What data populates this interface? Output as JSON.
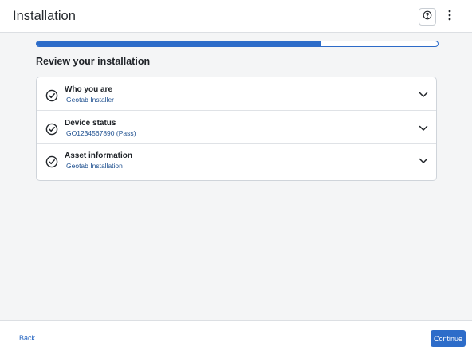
{
  "header": {
    "title": "Installation",
    "help_icon": "help-circle-icon",
    "more_icon": "more-vertical-icon"
  },
  "progress": {
    "fraction": 0.71,
    "color": "#2c6cc9"
  },
  "section_title": "Review your installation",
  "review_items": [
    {
      "title": "Who you are",
      "subtitle": "Geotab Installer",
      "status_icon": "check-circle-icon",
      "expand_icon": "chevron-down-icon"
    },
    {
      "title": "Device status",
      "subtitle": "GO1234567890 (Pass)",
      "status_icon": "check-circle-icon",
      "expand_icon": "chevron-down-icon"
    },
    {
      "title": "Asset information",
      "subtitle": "Geotab Installation",
      "status_icon": "check-circle-icon",
      "expand_icon": "chevron-down-icon"
    }
  ],
  "footer": {
    "back_label": "Back",
    "continue_label": "Continue",
    "accent": "#2d6cc9"
  }
}
